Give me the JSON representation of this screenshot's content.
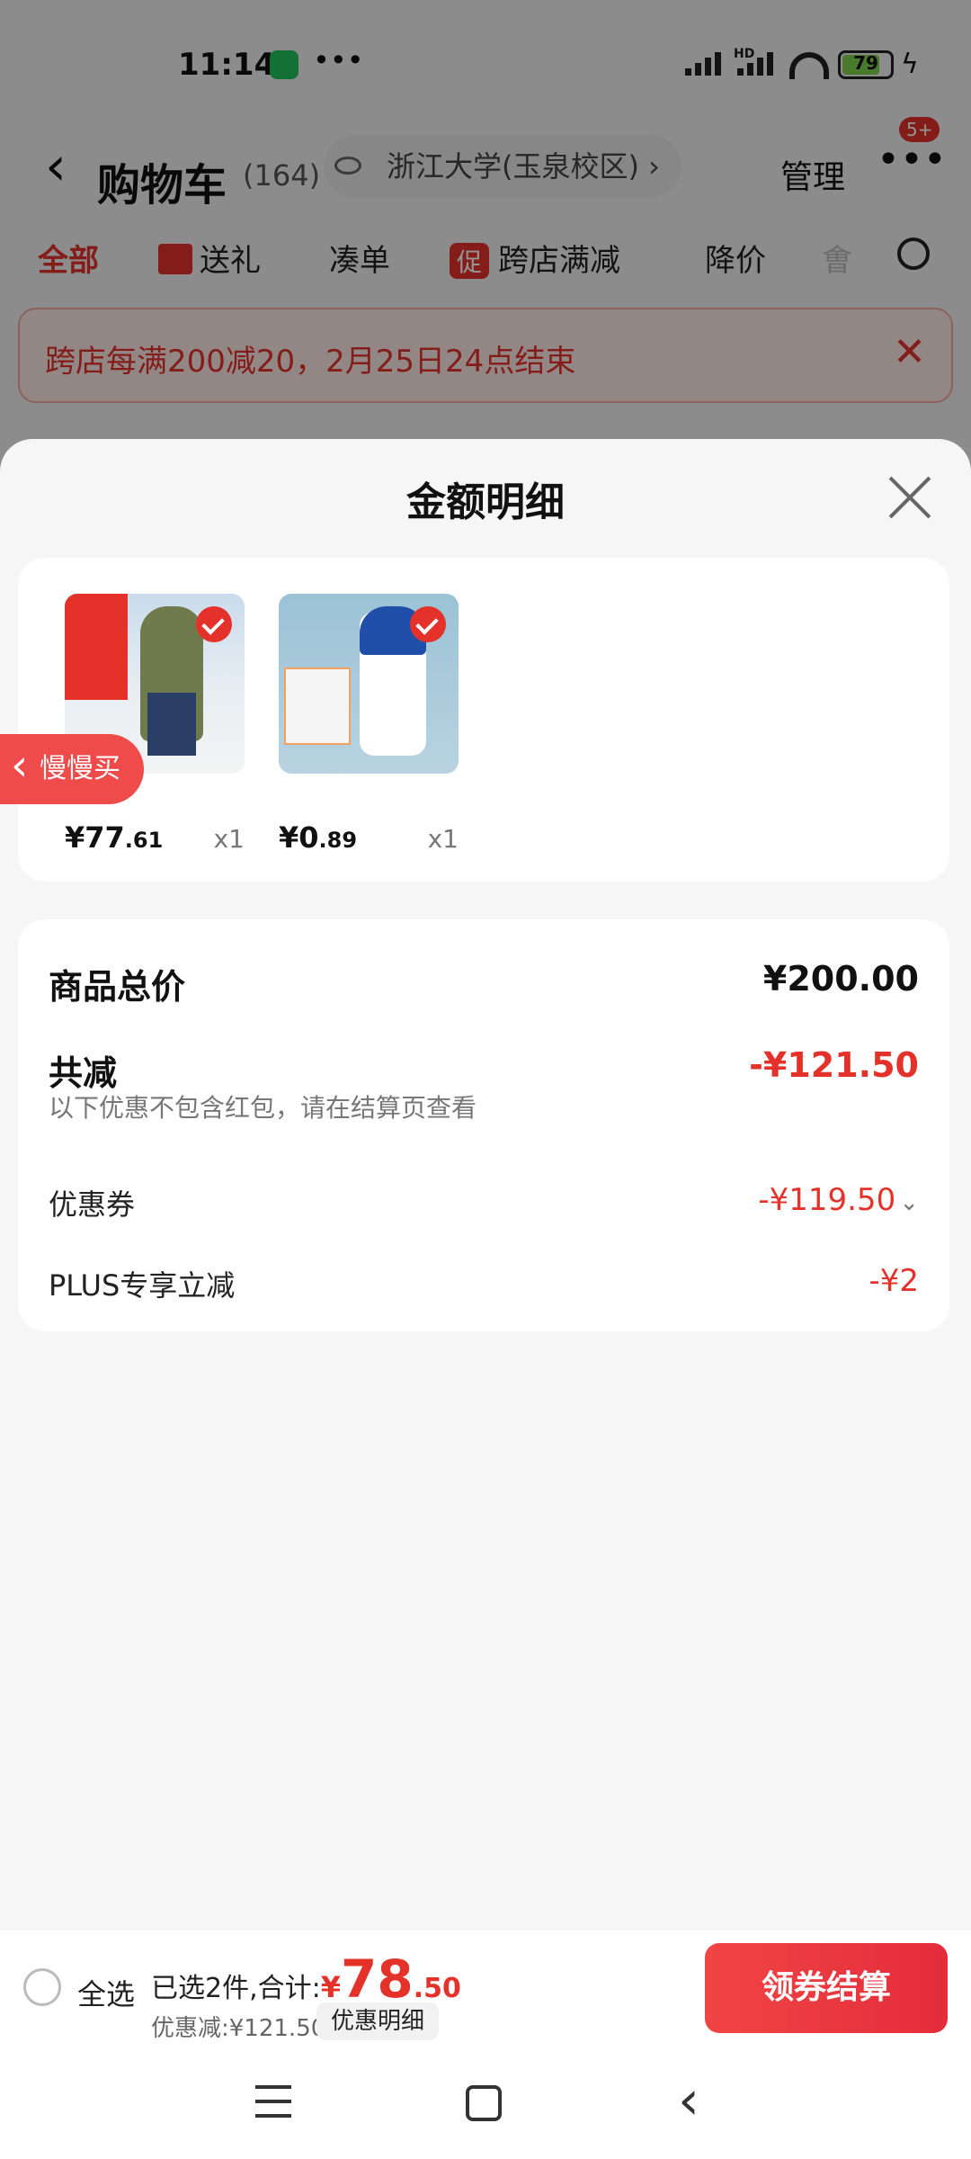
{
  "status_bar": {
    "time": "11:14",
    "battery": "79",
    "more": "•••",
    "net_label": "HD"
  },
  "header": {
    "title": "购物车",
    "count": "(164)",
    "location": "浙江大学(玉泉校区)",
    "location_arrow": "›",
    "manage": "管理",
    "badge": "5+"
  },
  "tabs": {
    "all": "全部",
    "gift": "送礼",
    "bundle": "凑单",
    "promo_tag": "促",
    "cross_store": "跨店满减",
    "price_drop": "降价",
    "partial": "㑹"
  },
  "banner": {
    "text": "跨店每满200减20，2月25日24点结束",
    "close": "✕"
  },
  "sheet": {
    "title": "金额明细",
    "products": [
      {
        "price_int": "¥77",
        "price_dec": ".61",
        "qty": "x1"
      },
      {
        "price_int": "¥0",
        "price_dec": ".89",
        "qty": "x1"
      }
    ],
    "slow_buy": "慢慢买",
    "summary": {
      "total_label": "商品总价",
      "total_value": "¥200.00",
      "reduce_label": "共减",
      "reduce_value": "-¥121.50",
      "note": "以下优惠不包含红包，请在结算页查看",
      "coupon_label": "优惠券",
      "coupon_value": "-¥119.50",
      "plus_label": "PLUS专享立减",
      "plus_value": "-¥2"
    }
  },
  "action_bar": {
    "select_all": "全选",
    "selected_text": "已选2件,合计:",
    "currency": "¥",
    "amount_int": "78",
    "amount_dec": ".50",
    "discount": "优惠减:¥121.50",
    "detail": "优惠明细",
    "checkout": "领券结算"
  },
  "colors": {
    "accent": "#e4322b",
    "sheet_bg": "#f6f6f6"
  }
}
